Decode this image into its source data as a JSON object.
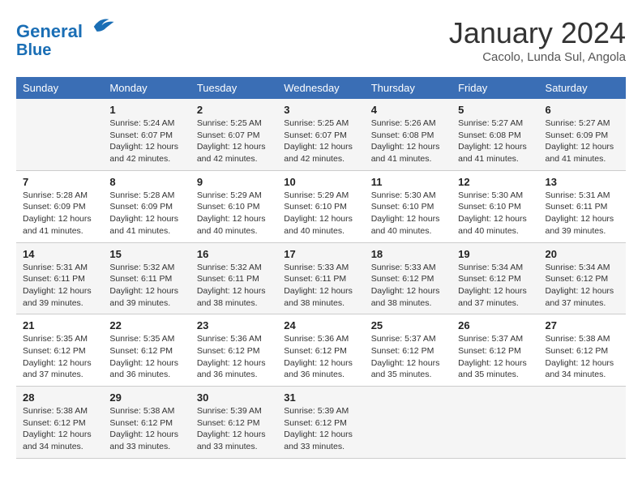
{
  "header": {
    "logo_line1": "General",
    "logo_line2": "Blue",
    "month": "January 2024",
    "location": "Cacolo, Lunda Sul, Angola"
  },
  "weekdays": [
    "Sunday",
    "Monday",
    "Tuesday",
    "Wednesday",
    "Thursday",
    "Friday",
    "Saturday"
  ],
  "weeks": [
    [
      {
        "day": "",
        "info": ""
      },
      {
        "day": "1",
        "info": "Sunrise: 5:24 AM\nSunset: 6:07 PM\nDaylight: 12 hours\nand 42 minutes."
      },
      {
        "day": "2",
        "info": "Sunrise: 5:25 AM\nSunset: 6:07 PM\nDaylight: 12 hours\nand 42 minutes."
      },
      {
        "day": "3",
        "info": "Sunrise: 5:25 AM\nSunset: 6:07 PM\nDaylight: 12 hours\nand 42 minutes."
      },
      {
        "day": "4",
        "info": "Sunrise: 5:26 AM\nSunset: 6:08 PM\nDaylight: 12 hours\nand 41 minutes."
      },
      {
        "day": "5",
        "info": "Sunrise: 5:27 AM\nSunset: 6:08 PM\nDaylight: 12 hours\nand 41 minutes."
      },
      {
        "day": "6",
        "info": "Sunrise: 5:27 AM\nSunset: 6:09 PM\nDaylight: 12 hours\nand 41 minutes."
      }
    ],
    [
      {
        "day": "7",
        "info": "Sunrise: 5:28 AM\nSunset: 6:09 PM\nDaylight: 12 hours\nand 41 minutes."
      },
      {
        "day": "8",
        "info": "Sunrise: 5:28 AM\nSunset: 6:09 PM\nDaylight: 12 hours\nand 41 minutes."
      },
      {
        "day": "9",
        "info": "Sunrise: 5:29 AM\nSunset: 6:10 PM\nDaylight: 12 hours\nand 40 minutes."
      },
      {
        "day": "10",
        "info": "Sunrise: 5:29 AM\nSunset: 6:10 PM\nDaylight: 12 hours\nand 40 minutes."
      },
      {
        "day": "11",
        "info": "Sunrise: 5:30 AM\nSunset: 6:10 PM\nDaylight: 12 hours\nand 40 minutes."
      },
      {
        "day": "12",
        "info": "Sunrise: 5:30 AM\nSunset: 6:10 PM\nDaylight: 12 hours\nand 40 minutes."
      },
      {
        "day": "13",
        "info": "Sunrise: 5:31 AM\nSunset: 6:11 PM\nDaylight: 12 hours\nand 39 minutes."
      }
    ],
    [
      {
        "day": "14",
        "info": "Sunrise: 5:31 AM\nSunset: 6:11 PM\nDaylight: 12 hours\nand 39 minutes."
      },
      {
        "day": "15",
        "info": "Sunrise: 5:32 AM\nSunset: 6:11 PM\nDaylight: 12 hours\nand 39 minutes."
      },
      {
        "day": "16",
        "info": "Sunrise: 5:32 AM\nSunset: 6:11 PM\nDaylight: 12 hours\nand 38 minutes."
      },
      {
        "day": "17",
        "info": "Sunrise: 5:33 AM\nSunset: 6:11 PM\nDaylight: 12 hours\nand 38 minutes."
      },
      {
        "day": "18",
        "info": "Sunrise: 5:33 AM\nSunset: 6:12 PM\nDaylight: 12 hours\nand 38 minutes."
      },
      {
        "day": "19",
        "info": "Sunrise: 5:34 AM\nSunset: 6:12 PM\nDaylight: 12 hours\nand 37 minutes."
      },
      {
        "day": "20",
        "info": "Sunrise: 5:34 AM\nSunset: 6:12 PM\nDaylight: 12 hours\nand 37 minutes."
      }
    ],
    [
      {
        "day": "21",
        "info": "Sunrise: 5:35 AM\nSunset: 6:12 PM\nDaylight: 12 hours\nand 37 minutes."
      },
      {
        "day": "22",
        "info": "Sunrise: 5:35 AM\nSunset: 6:12 PM\nDaylight: 12 hours\nand 36 minutes."
      },
      {
        "day": "23",
        "info": "Sunrise: 5:36 AM\nSunset: 6:12 PM\nDaylight: 12 hours\nand 36 minutes."
      },
      {
        "day": "24",
        "info": "Sunrise: 5:36 AM\nSunset: 6:12 PM\nDaylight: 12 hours\nand 36 minutes."
      },
      {
        "day": "25",
        "info": "Sunrise: 5:37 AM\nSunset: 6:12 PM\nDaylight: 12 hours\nand 35 minutes."
      },
      {
        "day": "26",
        "info": "Sunrise: 5:37 AM\nSunset: 6:12 PM\nDaylight: 12 hours\nand 35 minutes."
      },
      {
        "day": "27",
        "info": "Sunrise: 5:38 AM\nSunset: 6:12 PM\nDaylight: 12 hours\nand 34 minutes."
      }
    ],
    [
      {
        "day": "28",
        "info": "Sunrise: 5:38 AM\nSunset: 6:12 PM\nDaylight: 12 hours\nand 34 minutes."
      },
      {
        "day": "29",
        "info": "Sunrise: 5:38 AM\nSunset: 6:12 PM\nDaylight: 12 hours\nand 33 minutes."
      },
      {
        "day": "30",
        "info": "Sunrise: 5:39 AM\nSunset: 6:12 PM\nDaylight: 12 hours\nand 33 minutes."
      },
      {
        "day": "31",
        "info": "Sunrise: 5:39 AM\nSunset: 6:12 PM\nDaylight: 12 hours\nand 33 minutes."
      },
      {
        "day": "",
        "info": ""
      },
      {
        "day": "",
        "info": ""
      },
      {
        "day": "",
        "info": ""
      }
    ]
  ]
}
